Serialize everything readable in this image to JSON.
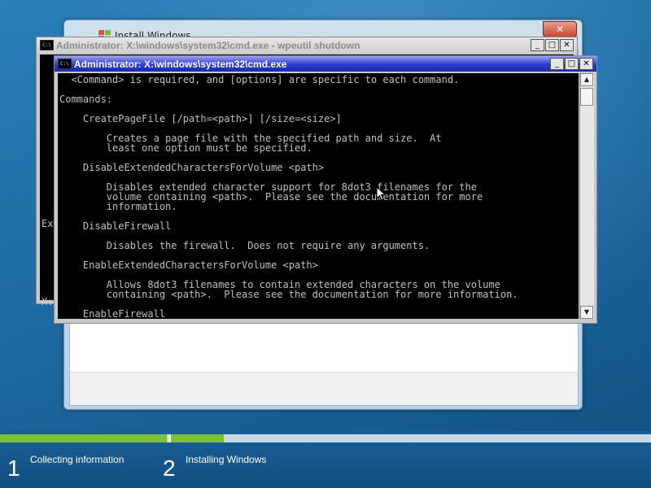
{
  "install_window": {
    "title": "Install Windows",
    "close_label": "✕"
  },
  "cmd_background": {
    "title": "Administrator: X:\\windows\\system32\\cmd.exe - wpeutil  shutdown",
    "visible_text_1": "Ex",
    "visible_text_2": "X:"
  },
  "cmd_foreground": {
    "title": "Administrator: X:\\windows\\system32\\cmd.exe",
    "lines": [
      "  <Command> is required, and [options] are specific to each command.",
      "",
      "Commands:",
      "",
      "    CreatePageFile [/path=<path>] [/size=<size>]",
      "",
      "        Creates a page file with the specified path and size.  At",
      "        least one option must be specified.",
      "",
      "    DisableExtendedCharactersForVolume <path>",
      "",
      "        Disables extended character support for 8dot3 filenames for the",
      "        volume containing <path>.  Please see the documentation for more",
      "        information.",
      "",
      "    DisableFirewall",
      "",
      "        Disables the firewall.  Does not require any arguments.",
      "",
      "    EnableExtendedCharactersForVolume <path>",
      "",
      "        Allows 8dot3 filenames to contain extended characters on the volume",
      "        containing <path>.  Please see the documentation for more information.",
      "",
      "    EnableFirewall"
    ]
  },
  "window_controls": {
    "minimize": "_",
    "maximize": "□",
    "close": "✕"
  },
  "scrollbar": {
    "up_arrow": "▲",
    "down_arrow": "▼"
  },
  "icon_label": "C:\\",
  "progress": {
    "steps": [
      {
        "number": "1",
        "label": "Collecting information"
      },
      {
        "number": "2",
        "label": "Installing Windows"
      }
    ],
    "colors": {
      "fill": "#7ec23a",
      "track": "#c8d8e6"
    }
  }
}
